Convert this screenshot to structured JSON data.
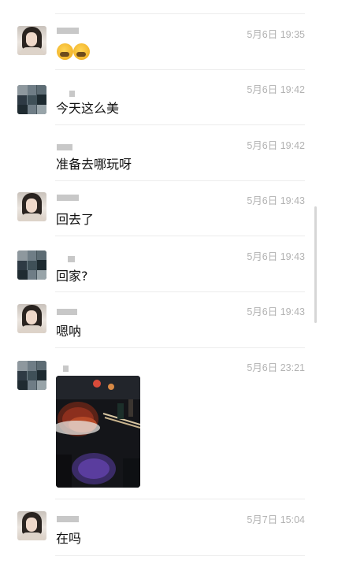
{
  "messages": [
    {
      "id": "m1",
      "avatar": "avatar-girl",
      "time": "5月6日 19:35",
      "text": ""
    },
    {
      "id": "m2",
      "avatar": "avatar-pixelated",
      "time": "5月6日 19:42",
      "text": "今天这么美"
    },
    {
      "id": "m3",
      "avatar": "",
      "time": "5月6日 19:42",
      "text": "准备去哪玩呀"
    },
    {
      "id": "m4",
      "avatar": "avatar-girl",
      "time": "5月6日 19:43",
      "text": "回去了"
    },
    {
      "id": "m5",
      "avatar": "avatar-pixelated",
      "time": "5月6日 19:43",
      "text": "回家?"
    },
    {
      "id": "m6",
      "avatar": "avatar-girl",
      "time": "5月6日 19:43",
      "text": "嗯呐"
    },
    {
      "id": "m7",
      "avatar": "avatar-pixelated",
      "time": "5月6日 23:21",
      "text": ""
    },
    {
      "id": "m8",
      "avatar": "avatar-girl",
      "time": "5月7日 15:04",
      "text": "在吗"
    }
  ],
  "icons": {
    "emoji": "facepalm-emoji-icon",
    "photo": "dinner-photo-thumbnail"
  },
  "colors": {
    "time": "#b2b2b2",
    "divider": "#ececec",
    "text": "#111111"
  }
}
